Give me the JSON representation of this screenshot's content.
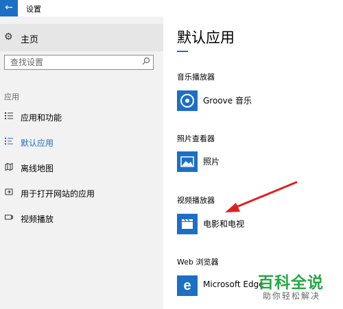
{
  "window": {
    "title": "设置",
    "back_glyph": "←"
  },
  "sidebar": {
    "home_label": "主页",
    "search": {
      "placeholder": "查找设置"
    },
    "section_label": "应用",
    "items": [
      {
        "label": "应用和功能",
        "icon": "apps-features-icon",
        "active": false
      },
      {
        "label": "默认应用",
        "icon": "default-apps-icon",
        "active": true
      },
      {
        "label": "离线地图",
        "icon": "offline-maps-icon",
        "active": false
      },
      {
        "label": "用于打开网站的应用",
        "icon": "apps-for-websites-icon",
        "active": false
      },
      {
        "label": "视频播放",
        "icon": "video-playback-icon",
        "active": false
      }
    ]
  },
  "main": {
    "title": "默认应用",
    "categories": [
      {
        "label": "音乐播放器",
        "app": "Groove 音乐",
        "icon": "groove-music-icon"
      },
      {
        "label": "照片查看器",
        "app": "照片",
        "icon": "photos-icon"
      },
      {
        "label": "视频播放器",
        "app": "电影和电视",
        "icon": "movies-tv-icon"
      },
      {
        "label": "Web 浏览器",
        "app": "Microsoft Edge",
        "icon": "edge-icon"
      }
    ]
  },
  "watermark": {
    "title": "百科全说",
    "subtitle": "助你轻松解决"
  },
  "colors": {
    "accent": "#1c6fc4",
    "sidebar_bg": "#f2f2f2",
    "annotation_arrow": "#e02020",
    "watermark_green": "#27a844"
  }
}
